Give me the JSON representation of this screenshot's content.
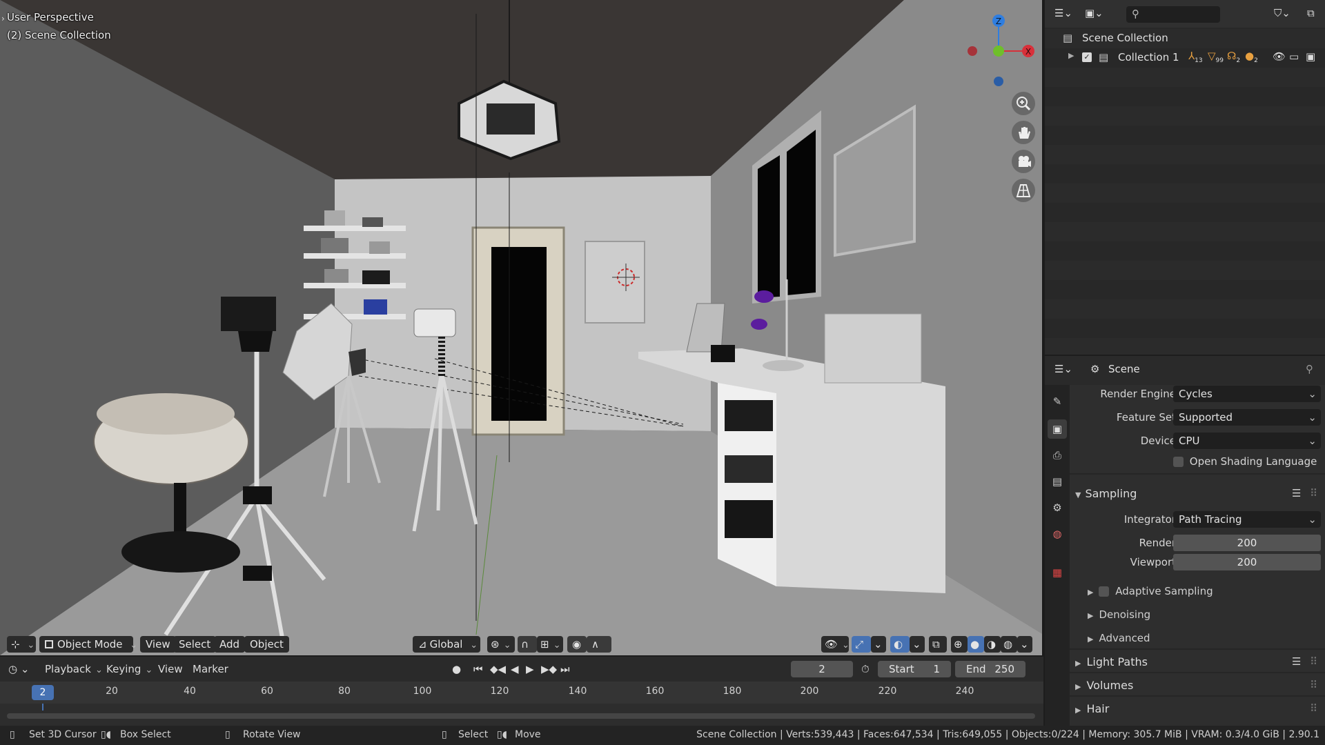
{
  "viewport": {
    "perspective_label": "User Perspective",
    "collection_label": "(2) Scene Collection",
    "gizmo_axes": {
      "z": "Z",
      "x": "X"
    },
    "nav_icons": [
      "zoom-icon",
      "hand-icon",
      "camera-icon",
      "grid-icon"
    ]
  },
  "vp_header": {
    "mode": "Object Mode",
    "menus": [
      "View",
      "Select",
      "Add",
      "Object"
    ],
    "transform_orientation": "Global"
  },
  "timeline": {
    "menus": {
      "playback": "Playback",
      "keying": "Keying",
      "view": "View",
      "marker": "Marker"
    },
    "current_frame": "2",
    "start_label": "Start",
    "start_value": "1",
    "end_label": "End",
    "end_value": "250",
    "ruler_ticks": [
      "20",
      "40",
      "60",
      "80",
      "100",
      "120",
      "140",
      "160",
      "180",
      "200",
      "220",
      "240"
    ],
    "playhead_label": "2"
  },
  "statusbar": {
    "set_cursor": "Set 3D Cursor",
    "box_select": "Box Select",
    "rotate_view": "Rotate View",
    "select": "Select",
    "move": "Move",
    "stats": "Scene Collection | Verts:539,443 | Faces:647,534 | Tris:649,055 | Objects:0/224 | Memory: 305.7 MiB | VRAM: 0.3/4.0 GiB | 2.90.1"
  },
  "outliner": {
    "root": "Scene Collection",
    "collection": "Collection 1",
    "counts": {
      "armatures": "13",
      "meshes": "99",
      "lights": "2",
      "materials": "2"
    }
  },
  "properties": {
    "scene_label": "Scene",
    "render_engine_label": "Render Engine",
    "render_engine": "Cycles",
    "feature_set_label": "Feature Set",
    "feature_set": "Supported",
    "device_label": "Device",
    "device": "CPU",
    "osl_label": "Open Shading Language",
    "sampling_label": "Sampling",
    "integrator_label": "Integrator",
    "integrator": "Path Tracing",
    "render_label": "Render",
    "render_value": "200",
    "viewport_label": "Viewport",
    "viewport_value": "200",
    "adaptive_label": "Adaptive Sampling",
    "denoising_label": "Denoising",
    "advanced_label": "Advanced",
    "light_paths_label": "Light Paths",
    "volumes_label": "Volumes",
    "hair_label": "Hair"
  }
}
